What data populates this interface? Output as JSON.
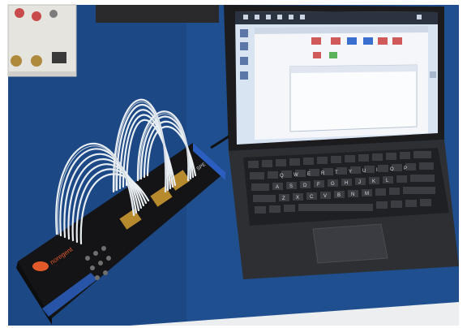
{
  "photo": {
    "device_brand": "noregent",
    "device_model": "SPE",
    "keyboard": {
      "row1": [
        "Q",
        "W",
        "E",
        "R",
        "T",
        "Y",
        "U",
        "I",
        "O",
        "P"
      ],
      "row2": [
        "A",
        "S",
        "D",
        "F",
        "G",
        "H",
        "J",
        "K",
        "L"
      ],
      "row3": [
        "Z",
        "X",
        "C",
        "V",
        "B",
        "N",
        "M"
      ]
    }
  },
  "colors": {
    "table_blue": "#1f4f8f",
    "device_body": "#141416",
    "device_accent_blue": "#2a5fc0",
    "cable_white": "#e9eef3",
    "connector_gold": "#b88a2e",
    "laptop_bezel": "#1c1c1e",
    "screen_bg": "#d9e4f3",
    "keyboard_base": "#2d2f33"
  }
}
